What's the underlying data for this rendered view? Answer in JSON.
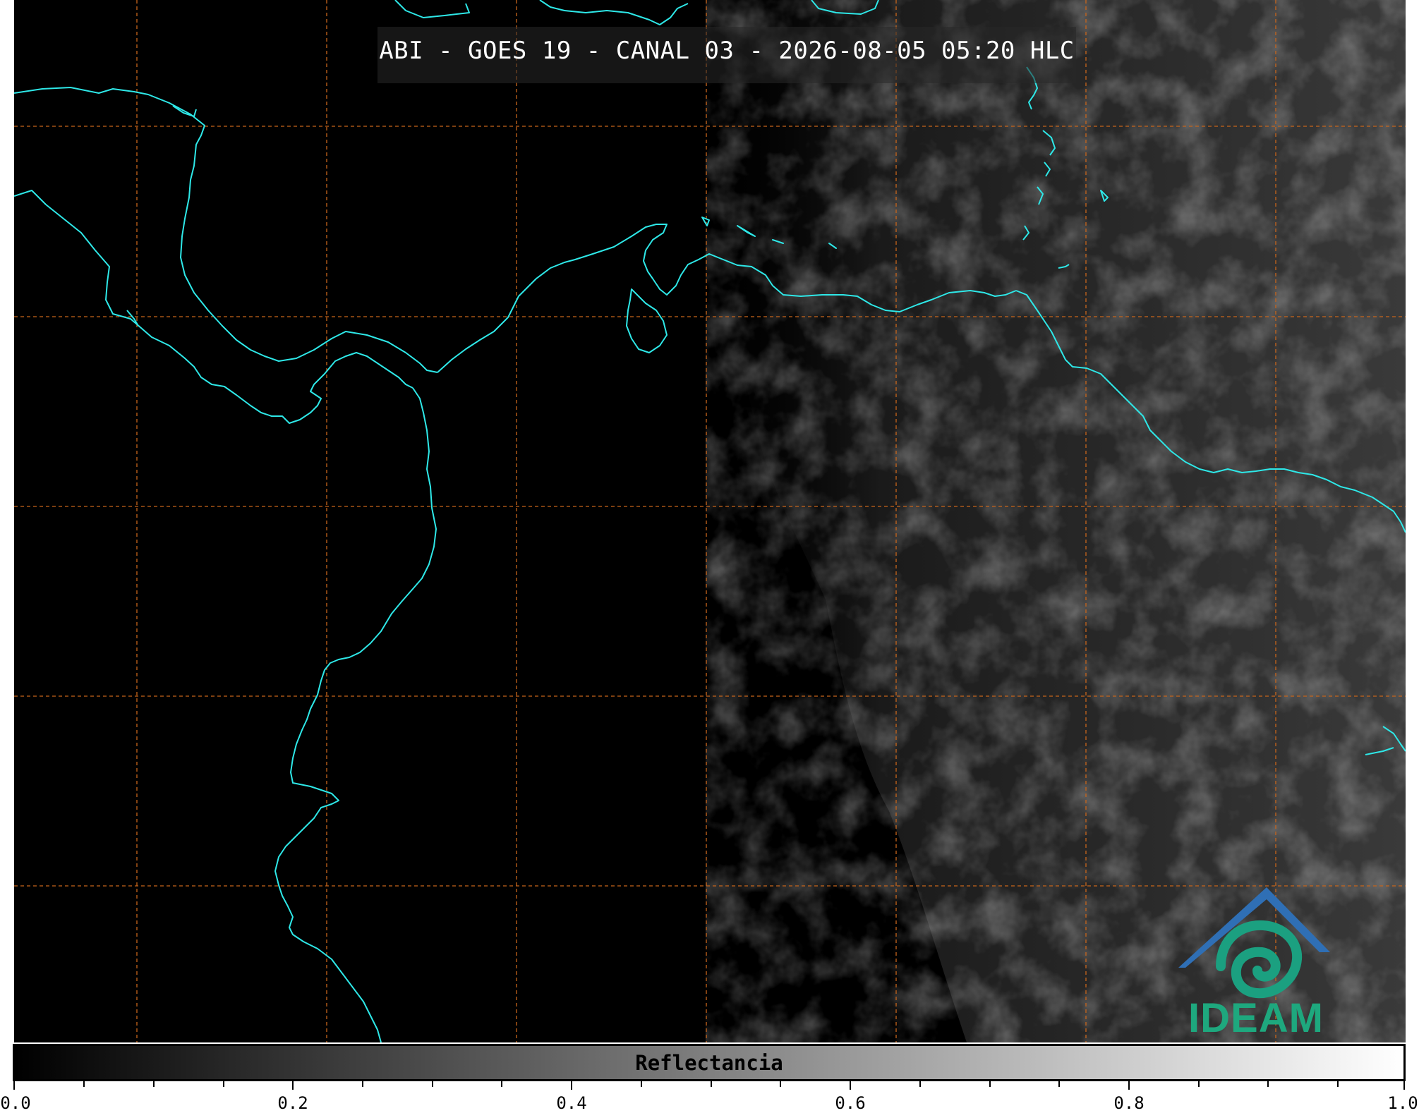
{
  "title": "ABI - GOES 19 - CANAL 03 - 2026-08-05 05:20 HLC",
  "colorbar": {
    "label": "Reflectancia",
    "ticks": [
      "0.0",
      "0.2",
      "0.4",
      "0.6",
      "0.8",
      "1.0"
    ],
    "range": [
      0.0,
      1.0
    ],
    "colormap": [
      "#000000",
      "#ffffff"
    ]
  },
  "logo": {
    "text": "IDEAM",
    "color": "#1ea87e",
    "roof_color": "#2f6fb5"
  },
  "colors": {
    "coastline": "#2ee8e8",
    "gridline": "#c8651b",
    "background_night": "#000000"
  }
}
